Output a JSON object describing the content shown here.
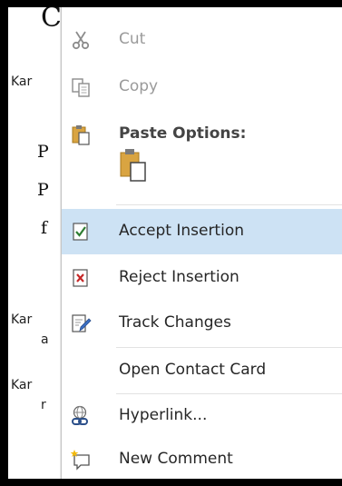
{
  "document": {
    "fragments": [
      {
        "text": "C",
        "kind": "serif"
      },
      {
        "text": "Kar",
        "kind": "name"
      },
      {
        "text": "P",
        "kind": "serif"
      },
      {
        "text": "P",
        "kind": "serif"
      },
      {
        "text": "f",
        "kind": "serif"
      },
      {
        "text": "Kar",
        "kind": "name"
      },
      {
        "text": "a",
        "kind": "name"
      },
      {
        "text": "Kar",
        "kind": "name"
      },
      {
        "text": "r",
        "kind": "name"
      }
    ]
  },
  "context_menu": {
    "items": [
      {
        "label": "Cut",
        "icon": "scissors-icon",
        "state": "disabled"
      },
      {
        "label": "Copy",
        "icon": "copy-icon",
        "state": "disabled"
      },
      {
        "label": "Paste Options:",
        "icon": "clipboard-icon",
        "state": "header"
      },
      {
        "label": "Accept Insertion",
        "icon": "accept-check-icon",
        "state": "highlighted"
      },
      {
        "label": "Reject Insertion",
        "icon": "reject-x-icon",
        "state": "normal"
      },
      {
        "label": "Track Changes",
        "icon": "track-changes-icon",
        "state": "normal"
      },
      {
        "label": "Open Contact Card",
        "icon": "",
        "state": "normal"
      },
      {
        "label": "Hyperlink...",
        "icon": "hyperlink-icon",
        "state": "normal"
      },
      {
        "label": "New Comment",
        "icon": "new-comment-icon",
        "state": "normal"
      }
    ],
    "paste_option_icon": "paste-keep-text-icon",
    "colors": {
      "highlight": "#cde2f4",
      "disabled_text": "#9a9a9a",
      "clipboard": "#d9a441",
      "accept": "#2e7d32",
      "reject": "#c62828"
    }
  }
}
